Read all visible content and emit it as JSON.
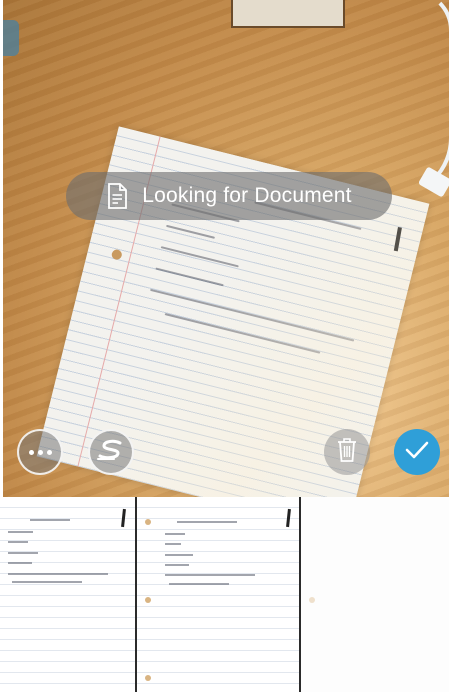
{
  "status": {
    "message": "Looking for Document",
    "icon": "document-icon"
  },
  "controls": {
    "more": {
      "icon": "more-icon"
    },
    "scan_mode": {
      "icon": "scan-logo-icon"
    },
    "delete": {
      "icon": "trash-icon"
    },
    "confirm": {
      "icon": "checkmark-icon",
      "color": "#2f9fd8"
    }
  },
  "thumbnails": [
    {
      "name": "scanned-page-1"
    },
    {
      "name": "scanned-page-2"
    },
    {
      "name": "scanned-page-3-blank"
    }
  ]
}
